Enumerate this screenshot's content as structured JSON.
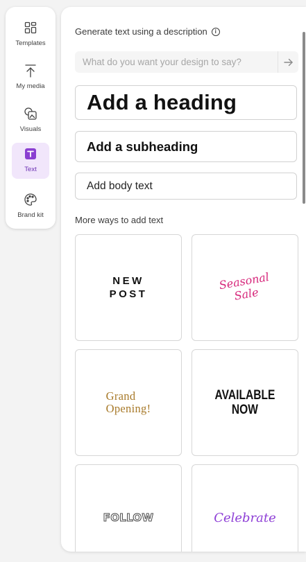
{
  "rail": {
    "items": [
      {
        "label": "Templates",
        "icon": "templates-icon",
        "active": false
      },
      {
        "label": "My media",
        "icon": "upload-icon",
        "active": false
      },
      {
        "label": "Visuals",
        "icon": "visuals-icon",
        "active": false
      },
      {
        "label": "Text",
        "icon": "text-icon",
        "active": true
      },
      {
        "label": "Brand kit",
        "icon": "palette-icon",
        "active": false
      }
    ]
  },
  "panel": {
    "generate_title": "Generate text using a description",
    "prompt_placeholder": "What do you want your design to say?",
    "heading_label": "Add a heading",
    "subheading_label": "Add a subheading",
    "body_label": "Add body text",
    "more_title": "More ways to add text",
    "tiles": [
      {
        "text": "NEW\nPOST"
      },
      {
        "text": "Seasonal\nSale"
      },
      {
        "text": "Grand\nOpening!"
      },
      {
        "text": "AVAILABLE\nNOW"
      },
      {
        "text": "FOLLOW"
      },
      {
        "text": "Celebrate"
      }
    ]
  },
  "colors": {
    "accent": "#6b2fb3",
    "active_bg": "#f1e6fb",
    "seasonal_pink": "#d6267a",
    "grand_gold": "#a87a2a",
    "celebrate_purple": "#8e3fd6"
  }
}
